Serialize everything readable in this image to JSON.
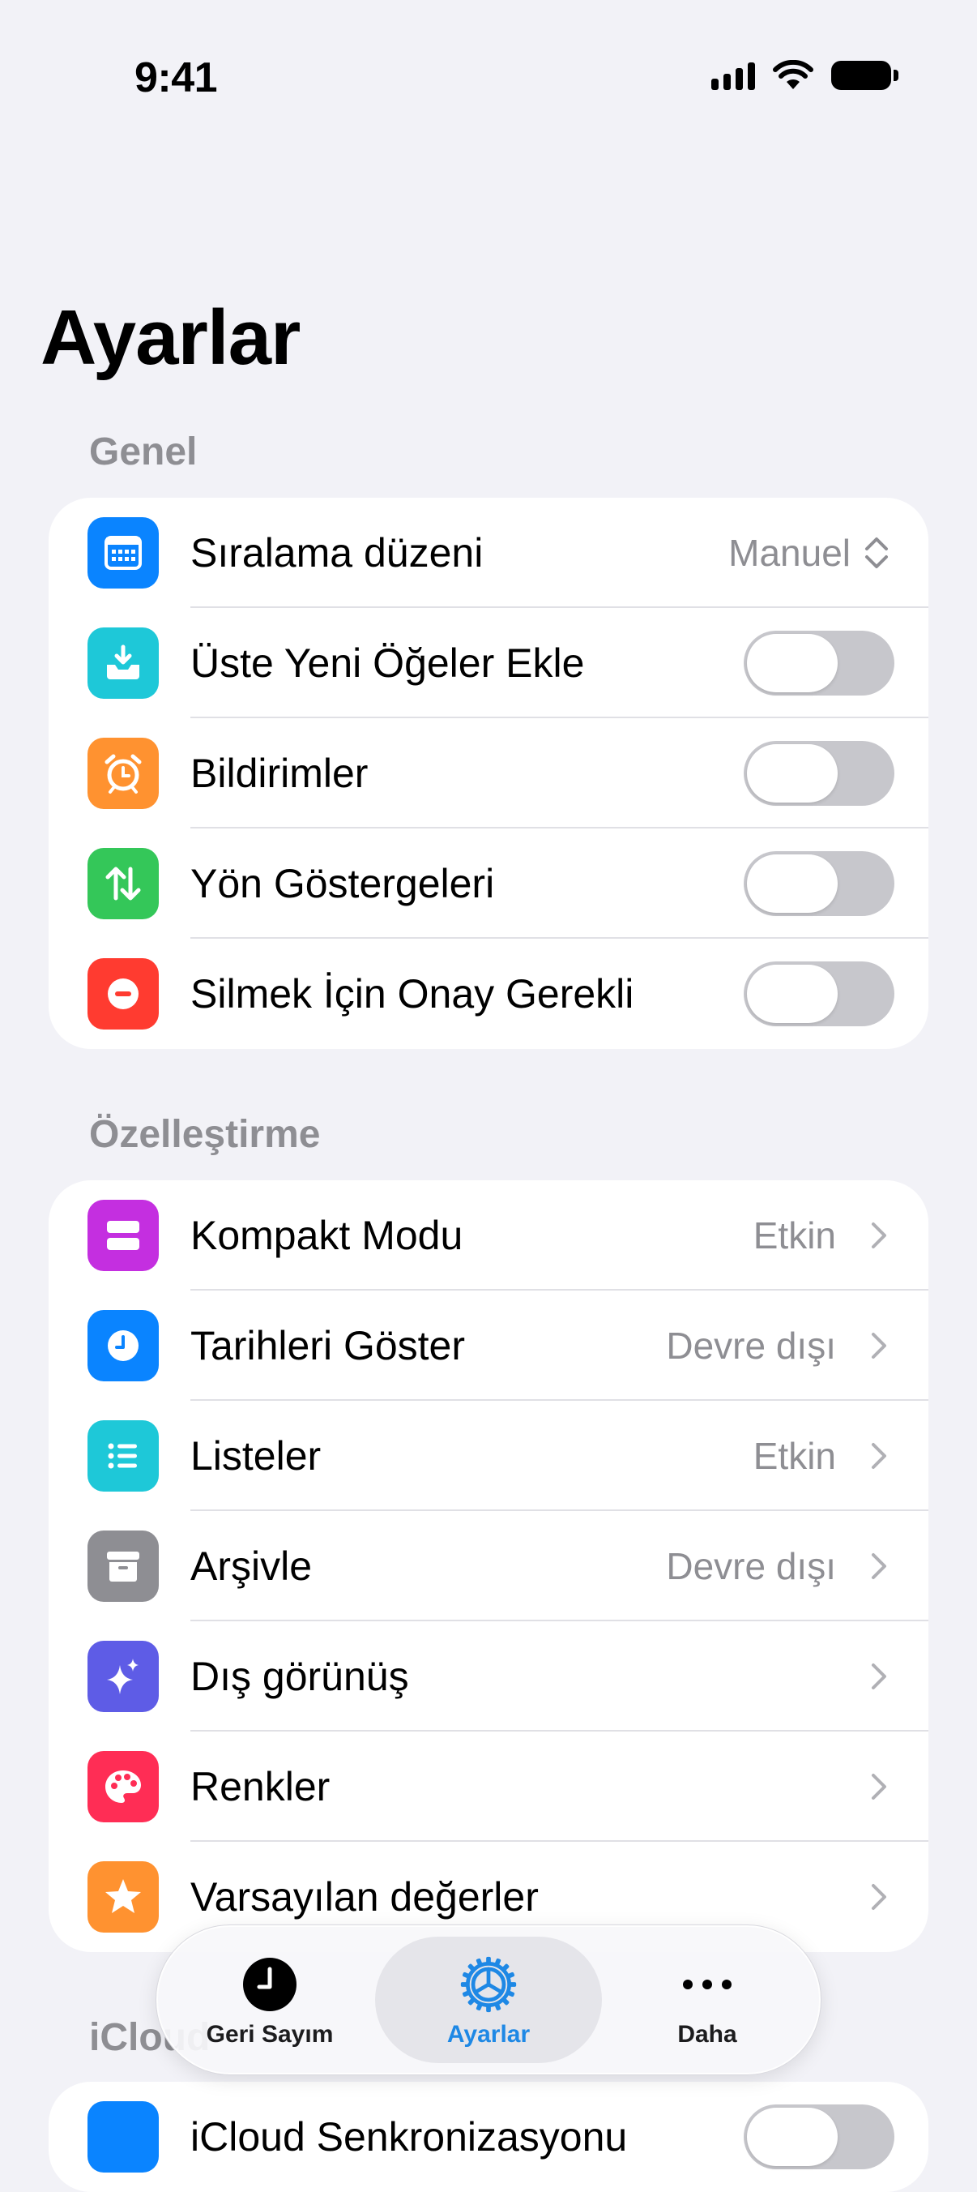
{
  "status_bar": {
    "time": "9:41"
  },
  "page_title": "Ayarlar",
  "sections": {
    "general": {
      "header": "Genel",
      "items": [
        {
          "label": "Sıralama düzeni",
          "value": "Manuel",
          "icon": "calendar-icon",
          "color": "#0A84FF"
        },
        {
          "label": "Üste Yeni Öğeler Ekle",
          "toggle": false,
          "icon": "tray-download-icon",
          "color": "#1EC8D8"
        },
        {
          "label": "Bildirimler",
          "toggle": false,
          "icon": "alarm-clock-icon",
          "color": "#FF9230"
        },
        {
          "label": "Yön Göstergeleri",
          "toggle": false,
          "icon": "up-down-arrows-icon",
          "color": "#34C759"
        },
        {
          "label": "Silmek İçin Onay Gerekli",
          "toggle": false,
          "icon": "minus-circle-icon",
          "color": "#FF3B30"
        }
      ]
    },
    "customization": {
      "header": "Özelleştirme",
      "items": [
        {
          "label": "Kompakt Modu",
          "value": "Etkin",
          "icon": "rectangles-icon",
          "color": "#C42FE0"
        },
        {
          "label": "Tarihleri Göster",
          "value": "Devre dışı",
          "icon": "clock-icon",
          "color": "#0A84FF"
        },
        {
          "label": "Listeler",
          "value": "Etkin",
          "icon": "list-icon",
          "color": "#1EC8D8"
        },
        {
          "label": "Arşivle",
          "value": "Devre dışı",
          "icon": "archive-box-icon",
          "color": "#8E8E93"
        },
        {
          "label": "Dış görünüş",
          "value": "",
          "icon": "sparkles-icon",
          "color": "#5E5CE6"
        },
        {
          "label": "Renkler",
          "value": "",
          "icon": "palette-icon",
          "color": "#FF2D55"
        },
        {
          "label": "Varsayılan değerler",
          "value": "",
          "icon": "star-icon",
          "color": "#FF9230"
        }
      ]
    },
    "icloud": {
      "header": "iCloud",
      "items": [
        {
          "label": "iCloud Senkronizasyonu",
          "toggle": false
        }
      ]
    }
  },
  "tab_bar": {
    "tabs": [
      {
        "label": "Geri Sayım",
        "icon": "clock-filled-icon",
        "active": false
      },
      {
        "label": "Ayarlar",
        "icon": "gear-icon",
        "active": true,
        "color": "#1E88E5"
      },
      {
        "label": "Daha",
        "icon": "ellipsis-icon",
        "active": false
      }
    ]
  }
}
